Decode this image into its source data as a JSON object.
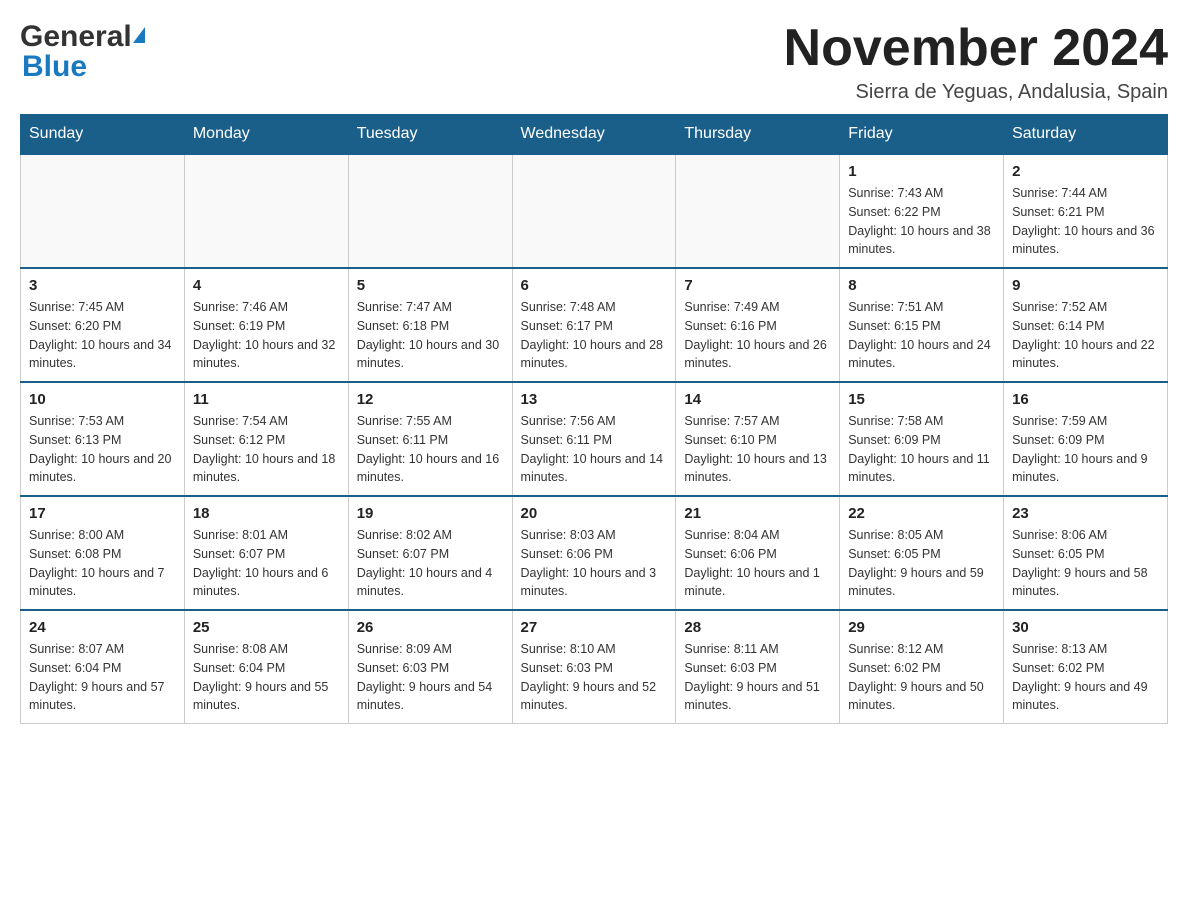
{
  "logo": {
    "general": "General",
    "blue": "Blue"
  },
  "header": {
    "title": "November 2024",
    "subtitle": "Sierra de Yeguas, Andalusia, Spain"
  },
  "weekdays": [
    "Sunday",
    "Monday",
    "Tuesday",
    "Wednesday",
    "Thursday",
    "Friday",
    "Saturday"
  ],
  "weeks": [
    [
      {
        "day": "",
        "info": ""
      },
      {
        "day": "",
        "info": ""
      },
      {
        "day": "",
        "info": ""
      },
      {
        "day": "",
        "info": ""
      },
      {
        "day": "",
        "info": ""
      },
      {
        "day": "1",
        "info": "Sunrise: 7:43 AM\nSunset: 6:22 PM\nDaylight: 10 hours and 38 minutes."
      },
      {
        "day": "2",
        "info": "Sunrise: 7:44 AM\nSunset: 6:21 PM\nDaylight: 10 hours and 36 minutes."
      }
    ],
    [
      {
        "day": "3",
        "info": "Sunrise: 7:45 AM\nSunset: 6:20 PM\nDaylight: 10 hours and 34 minutes."
      },
      {
        "day": "4",
        "info": "Sunrise: 7:46 AM\nSunset: 6:19 PM\nDaylight: 10 hours and 32 minutes."
      },
      {
        "day": "5",
        "info": "Sunrise: 7:47 AM\nSunset: 6:18 PM\nDaylight: 10 hours and 30 minutes."
      },
      {
        "day": "6",
        "info": "Sunrise: 7:48 AM\nSunset: 6:17 PM\nDaylight: 10 hours and 28 minutes."
      },
      {
        "day": "7",
        "info": "Sunrise: 7:49 AM\nSunset: 6:16 PM\nDaylight: 10 hours and 26 minutes."
      },
      {
        "day": "8",
        "info": "Sunrise: 7:51 AM\nSunset: 6:15 PM\nDaylight: 10 hours and 24 minutes."
      },
      {
        "day": "9",
        "info": "Sunrise: 7:52 AM\nSunset: 6:14 PM\nDaylight: 10 hours and 22 minutes."
      }
    ],
    [
      {
        "day": "10",
        "info": "Sunrise: 7:53 AM\nSunset: 6:13 PM\nDaylight: 10 hours and 20 minutes."
      },
      {
        "day": "11",
        "info": "Sunrise: 7:54 AM\nSunset: 6:12 PM\nDaylight: 10 hours and 18 minutes."
      },
      {
        "day": "12",
        "info": "Sunrise: 7:55 AM\nSunset: 6:11 PM\nDaylight: 10 hours and 16 minutes."
      },
      {
        "day": "13",
        "info": "Sunrise: 7:56 AM\nSunset: 6:11 PM\nDaylight: 10 hours and 14 minutes."
      },
      {
        "day": "14",
        "info": "Sunrise: 7:57 AM\nSunset: 6:10 PM\nDaylight: 10 hours and 13 minutes."
      },
      {
        "day": "15",
        "info": "Sunrise: 7:58 AM\nSunset: 6:09 PM\nDaylight: 10 hours and 11 minutes."
      },
      {
        "day": "16",
        "info": "Sunrise: 7:59 AM\nSunset: 6:09 PM\nDaylight: 10 hours and 9 minutes."
      }
    ],
    [
      {
        "day": "17",
        "info": "Sunrise: 8:00 AM\nSunset: 6:08 PM\nDaylight: 10 hours and 7 minutes."
      },
      {
        "day": "18",
        "info": "Sunrise: 8:01 AM\nSunset: 6:07 PM\nDaylight: 10 hours and 6 minutes."
      },
      {
        "day": "19",
        "info": "Sunrise: 8:02 AM\nSunset: 6:07 PM\nDaylight: 10 hours and 4 minutes."
      },
      {
        "day": "20",
        "info": "Sunrise: 8:03 AM\nSunset: 6:06 PM\nDaylight: 10 hours and 3 minutes."
      },
      {
        "day": "21",
        "info": "Sunrise: 8:04 AM\nSunset: 6:06 PM\nDaylight: 10 hours and 1 minute."
      },
      {
        "day": "22",
        "info": "Sunrise: 8:05 AM\nSunset: 6:05 PM\nDaylight: 9 hours and 59 minutes."
      },
      {
        "day": "23",
        "info": "Sunrise: 8:06 AM\nSunset: 6:05 PM\nDaylight: 9 hours and 58 minutes."
      }
    ],
    [
      {
        "day": "24",
        "info": "Sunrise: 8:07 AM\nSunset: 6:04 PM\nDaylight: 9 hours and 57 minutes."
      },
      {
        "day": "25",
        "info": "Sunrise: 8:08 AM\nSunset: 6:04 PM\nDaylight: 9 hours and 55 minutes."
      },
      {
        "day": "26",
        "info": "Sunrise: 8:09 AM\nSunset: 6:03 PM\nDaylight: 9 hours and 54 minutes."
      },
      {
        "day": "27",
        "info": "Sunrise: 8:10 AM\nSunset: 6:03 PM\nDaylight: 9 hours and 52 minutes."
      },
      {
        "day": "28",
        "info": "Sunrise: 8:11 AM\nSunset: 6:03 PM\nDaylight: 9 hours and 51 minutes."
      },
      {
        "day": "29",
        "info": "Sunrise: 8:12 AM\nSunset: 6:02 PM\nDaylight: 9 hours and 50 minutes."
      },
      {
        "day": "30",
        "info": "Sunrise: 8:13 AM\nSunset: 6:02 PM\nDaylight: 9 hours and 49 minutes."
      }
    ]
  ]
}
